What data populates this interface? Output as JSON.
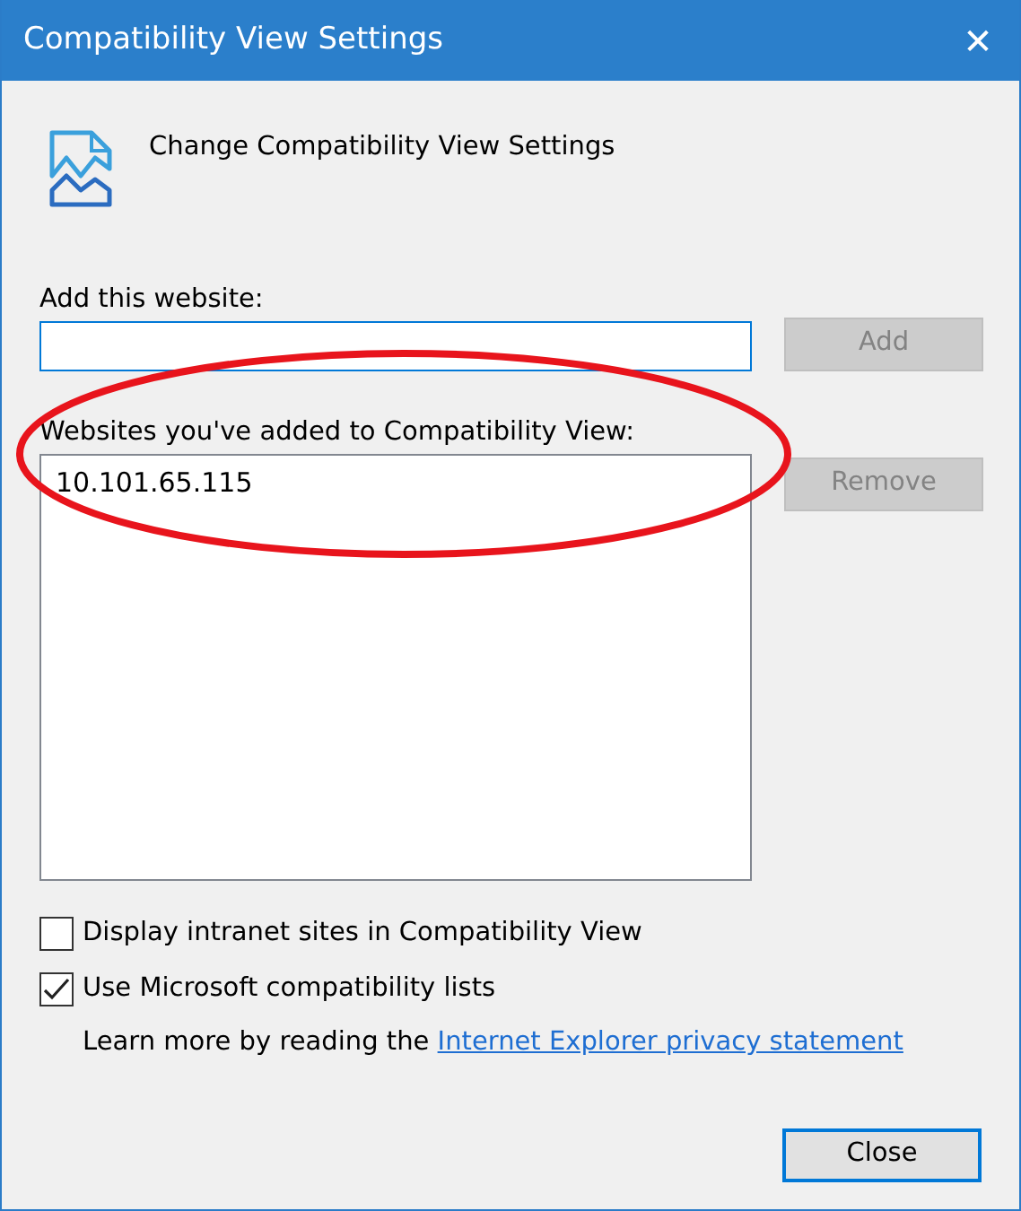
{
  "window": {
    "title": "Compatibility View Settings",
    "close": "✕"
  },
  "header": {
    "title": "Change Compatibility View Settings"
  },
  "add_website": {
    "label": "Add this website:",
    "focused": true,
    "button": {
      "label": "Add",
      "disabled": true
    }
  },
  "websites": {
    "label": "Websites you've added to Compatibility View:",
    "items": [
      {
        "text": "10.101.65.115",
        "selected": false
      }
    ],
    "button": {
      "label": "Remove",
      "disabled": true
    }
  },
  "options": [
    {
      "label": "Display intranet sites in Compatibility View",
      "checked": false
    },
    {
      "label": "Use Microsoft compatibility lists",
      "checked": true
    }
  ],
  "learn_more": {
    "text": "Learn more by reading the ",
    "link": "Internet Explorer privacy statement"
  },
  "buttons": [
    {
      "label": "Close",
      "default": true
    }
  ],
  "annotations": [
    {
      "kind": "ellipse"
    }
  ]
}
